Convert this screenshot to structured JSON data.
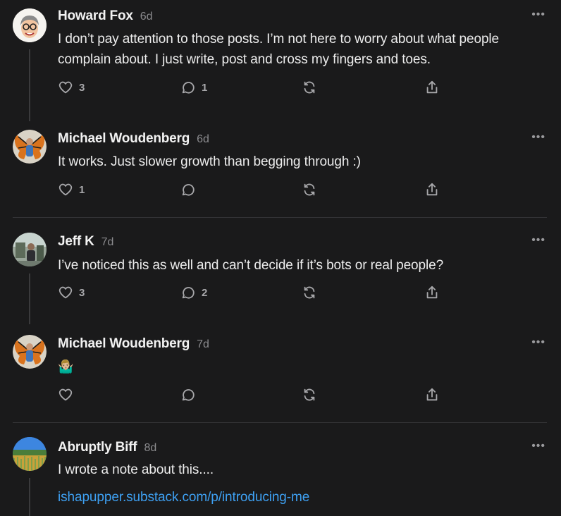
{
  "colors": {
    "background": "#1a1a1b",
    "text": "#ededed",
    "muted": "#8b8b8e",
    "link": "#3ea0f2",
    "divider": "#333336"
  },
  "posts": [
    {
      "author": "Howard Fox",
      "time": "6d",
      "text": "I don’t pay attention to those posts. I’m not here to worry about what people complain about. I just write, post and cross my fingers and toes.",
      "likes": "3",
      "comments": "1",
      "avatar_icon": "cartoon-face-avatar"
    },
    {
      "author": "Michael Woudenberg",
      "time": "6d",
      "text": "It works. Just slower growth than begging through :)",
      "likes": "1",
      "comments": "",
      "avatar_icon": "butterfly-wings-avatar"
    },
    {
      "author": "Jeff K",
      "time": "7d",
      "text": "I’ve noticed this as well and can’t decide if it’s bots or real people?",
      "likes": "3",
      "comments": "2",
      "avatar_icon": "photo-avatar"
    },
    {
      "author": "Michael Woudenberg",
      "time": "7d",
      "text": "🤷🏼‍♂️",
      "likes": "",
      "comments": "",
      "avatar_icon": "butterfly-wings-avatar"
    },
    {
      "author": "Abruptly Biff",
      "time": "8d",
      "text": "I wrote a note about this....",
      "link": "ishapupper.substack.com/p/introducing-me",
      "avatar_icon": "field-landscape-avatar"
    }
  ],
  "more_label": "•••",
  "icons": {
    "like": "heart-icon",
    "comment": "comment-icon",
    "restack": "restack-icon",
    "share": "share-icon",
    "more": "more-options-icon"
  }
}
